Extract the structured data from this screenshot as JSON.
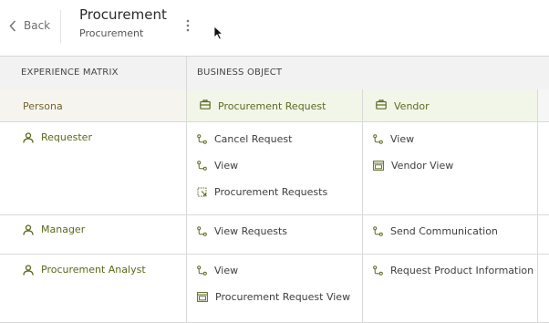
{
  "header": {
    "back_label": "Back",
    "title": "Procurement",
    "subtitle": "Procurement"
  },
  "table": {
    "col_experience_matrix": "EXPERIENCE MATRIX",
    "col_business_object": "BUSINESS OBJECT",
    "persona_header": "Persona",
    "business_objects": [
      "Procurement Request",
      "Vendor"
    ],
    "rows": [
      {
        "persona": "Requester",
        "procurement_request": [
          "Cancel Request",
          "View",
          "Procurement Requests"
        ],
        "vendor": [
          "View",
          "Vendor View"
        ]
      },
      {
        "persona": "Manager",
        "procurement_request": [
          "View Requests"
        ],
        "vendor": [
          "Send Communication"
        ]
      },
      {
        "persona": "Procurement Analyst",
        "procurement_request": [
          "View",
          "Procurement Request View"
        ],
        "vendor": [
          "Request Product Information"
        ]
      }
    ]
  },
  "colors": {
    "persona_text": "#5c6619",
    "business_object_header_bg": "#f1f6e8",
    "header_bg": "#f2f2f2"
  },
  "icons": {
    "persona": "person-icon",
    "business_object": "briefcase-icon",
    "action": "flow-icon",
    "view": "window-icon",
    "list": "list-icon"
  }
}
